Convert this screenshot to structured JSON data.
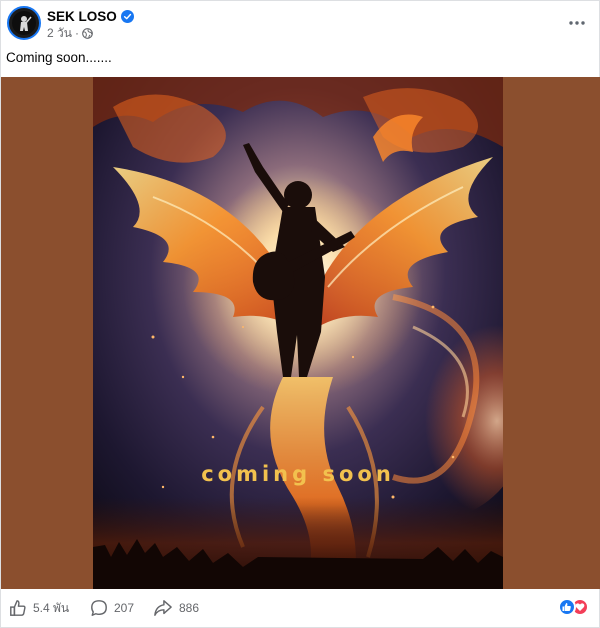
{
  "post": {
    "author": "SEK LOSO",
    "time": "2 วัน",
    "separator": "·",
    "text": "Coming soon.......",
    "image_text": "coming soon"
  },
  "stats": {
    "likes": "5.4 พัน",
    "comments": "207",
    "shares": "886"
  },
  "colors": {
    "accent": "#1877f2",
    "love": "#f33e58",
    "media_background": "#8b4f2e",
    "muted_text": "#65676b"
  },
  "icons": {
    "verified": "verified-badge-icon",
    "audience": "globe-icon",
    "more": "more-options-icon",
    "like": "thumbs-up-icon",
    "comment": "comment-bubble-icon",
    "share": "share-arrow-icon",
    "reaction_like": "like-reaction-icon",
    "reaction_love": "love-reaction-icon"
  }
}
